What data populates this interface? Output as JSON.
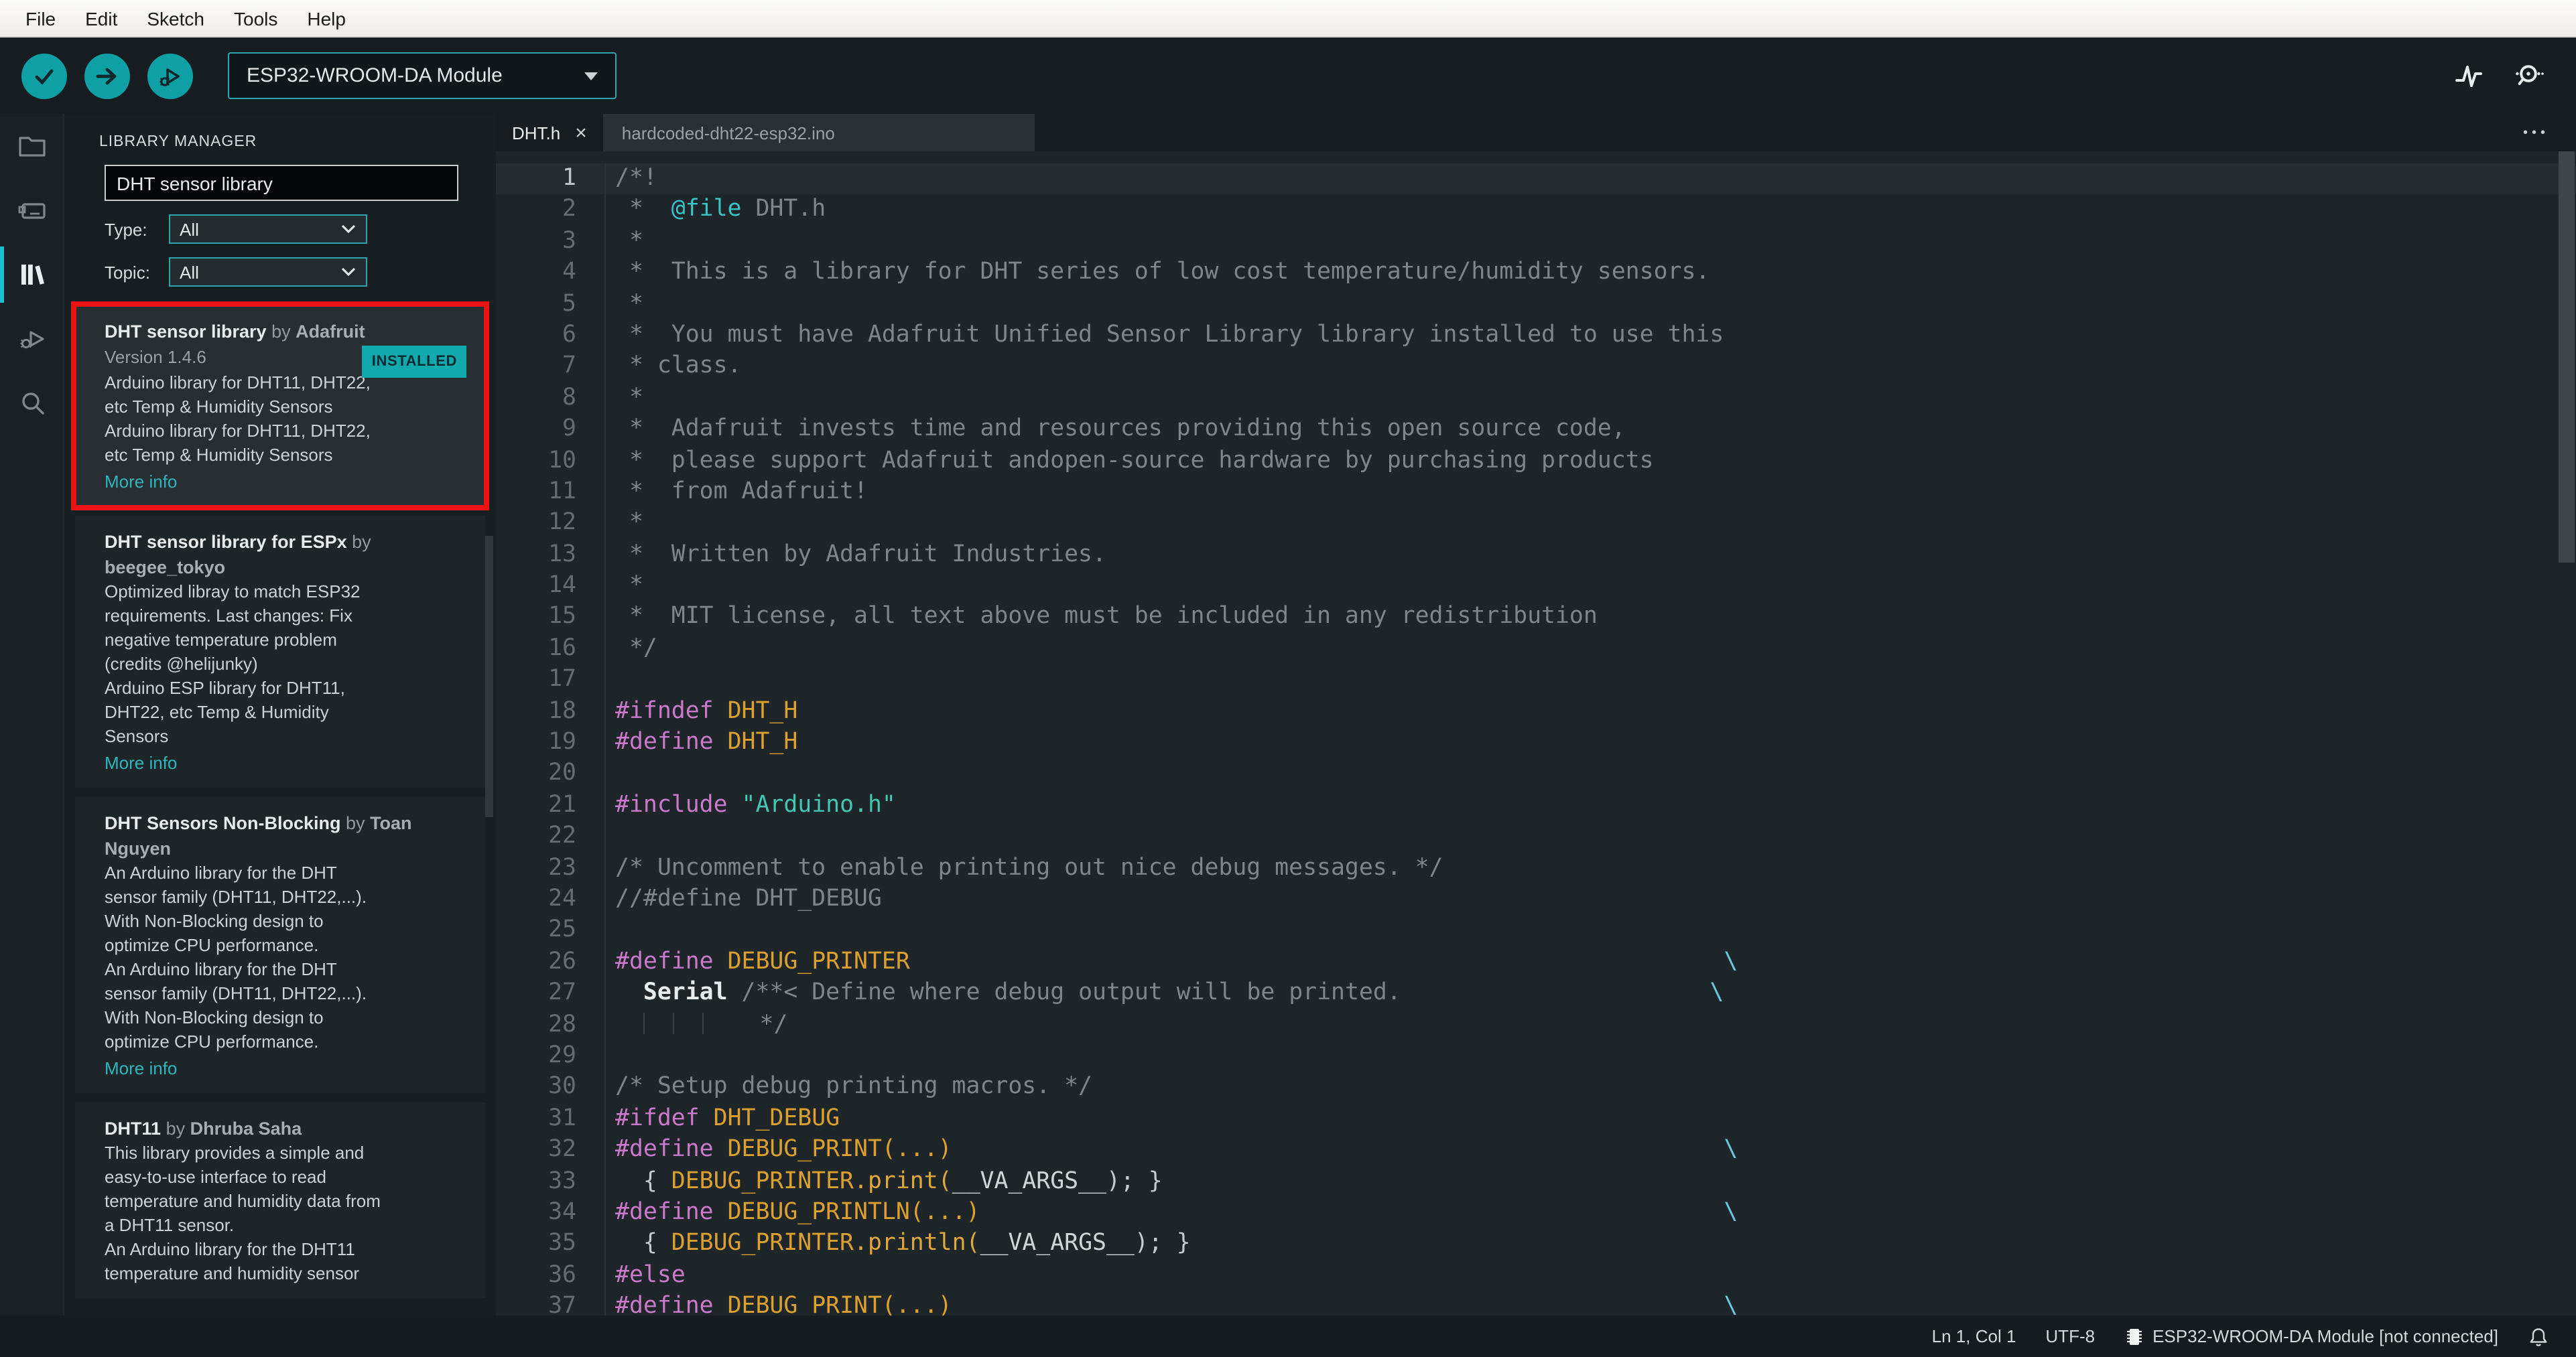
{
  "menu_bar": {
    "items": [
      "File",
      "Edit",
      "Sketch",
      "Tools",
      "Help"
    ]
  },
  "toolbar": {
    "buttons": [
      {
        "icon": "verify-check-icon"
      },
      {
        "icon": "upload-arrow-icon"
      },
      {
        "icon": "debug-icon"
      }
    ],
    "board_selector": {
      "value": "ESP32-WROOM-DA Module",
      "icon": "dropdown-caret-icon"
    },
    "right_icons": [
      {
        "icon": "serial-plotter-icon"
      },
      {
        "icon": "serial-monitor-icon"
      }
    ]
  },
  "activity_bar": {
    "items": [
      {
        "icon": "sketchbook-folder-icon",
        "active": false
      },
      {
        "icon": "boards-manager-icon",
        "active": false
      },
      {
        "icon": "library-manager-icon",
        "active": true
      },
      {
        "icon": "debug-sidebar-icon",
        "active": false
      },
      {
        "icon": "search-icon",
        "active": false
      }
    ]
  },
  "library_manager": {
    "title": "LIBRARY MANAGER",
    "search_value": "DHT sensor library",
    "filters": [
      {
        "label": "Type:",
        "value": "All"
      },
      {
        "label": "Topic:",
        "value": "All"
      }
    ],
    "libraries": [
      {
        "name": "DHT sensor library",
        "by": " by ",
        "author": "Adafruit",
        "version_label": "Version 1.4.6",
        "installed_badge": "INSTALLED",
        "description_lines": [
          "Arduino library for DHT11, DHT22,",
          "etc Temp & Humidity Sensors",
          "Arduino library for DHT11, DHT22,",
          "etc Temp & Humidity Sensors"
        ],
        "more_info": "More info",
        "selected": true,
        "annotated": true
      },
      {
        "name": "DHT sensor library for ESPx",
        "by": " by ",
        "author": "beegee_tokyo",
        "description_lines": [
          "Optimized libray to match ESP32",
          "requirements. Last changes: Fix",
          "negative temperature problem",
          "(credits @helijunky)",
          "Arduino ESP library for DHT11,",
          "DHT22, etc Temp & Humidity",
          "Sensors"
        ],
        "more_info": "More info",
        "selected": false,
        "annotated": false
      },
      {
        "name": "DHT Sensors Non-Blocking",
        "by": " by ",
        "author": "Toan Nguyen",
        "description_lines": [
          "An Arduino library for the DHT",
          "sensor family (DHT11, DHT22,...).",
          "With Non-Blocking design to",
          "optimize CPU performance.",
          "An Arduino library for the DHT",
          "sensor family (DHT11, DHT22,...).",
          "With Non-Blocking design to",
          "optimize CPU performance."
        ],
        "more_info": "More info",
        "selected": false,
        "annotated": false
      },
      {
        "name": "DHT11",
        "by": " by ",
        "author": "Dhruba Saha",
        "description_lines": [
          "This library provides a simple and",
          "easy-to-use interface to read",
          "temperature and humidity data from",
          "a DHT11 sensor.",
          "An Arduino library for the DHT11",
          "temperature and humidity sensor"
        ],
        "more_info": null,
        "selected": false,
        "annotated": false
      }
    ]
  },
  "editor": {
    "tabs": [
      {
        "label": "DHT.h",
        "active": true,
        "close_icon": "close-x-icon"
      },
      {
        "label": "hardcoded-dht22-esp32.ino",
        "active": false
      }
    ],
    "more_actions_label": "•••",
    "lines": [
      {
        "n": 1,
        "hl": true,
        "tk": [
          [
            "c",
            "/*!"
          ]
        ]
      },
      {
        "n": 2,
        "tk": [
          [
            "c",
            " *  "
          ],
          [
            "d",
            "@file"
          ],
          [
            "c",
            " DHT.h"
          ]
        ]
      },
      {
        "n": 3,
        "tk": [
          [
            "c",
            " *"
          ]
        ]
      },
      {
        "n": 4,
        "tk": [
          [
            "c",
            " *  This is a library for DHT series of low cost temperature/humidity sensors."
          ]
        ]
      },
      {
        "n": 5,
        "tk": [
          [
            "c",
            " *"
          ]
        ]
      },
      {
        "n": 6,
        "tk": [
          [
            "c",
            " *  You must have Adafruit Unified Sensor Library library installed to use this"
          ]
        ]
      },
      {
        "n": 7,
        "tk": [
          [
            "c",
            " * class."
          ]
        ]
      },
      {
        "n": 8,
        "tk": [
          [
            "c",
            " *"
          ]
        ]
      },
      {
        "n": 9,
        "tk": [
          [
            "c",
            " *  Adafruit invests time and resources providing this open source code,"
          ]
        ]
      },
      {
        "n": 10,
        "tk": [
          [
            "c",
            " *  please support Adafruit andopen-source hardware by purchasing products"
          ]
        ]
      },
      {
        "n": 11,
        "tk": [
          [
            "c",
            " *  from Adafruit!"
          ]
        ]
      },
      {
        "n": 12,
        "tk": [
          [
            "c",
            " *"
          ]
        ]
      },
      {
        "n": 13,
        "tk": [
          [
            "c",
            " *  Written by Adafruit Industries."
          ]
        ]
      },
      {
        "n": 14,
        "tk": [
          [
            "c",
            " *"
          ]
        ]
      },
      {
        "n": 15,
        "tk": [
          [
            "c",
            " *  MIT license, all text above must be included in any redistribution"
          ]
        ]
      },
      {
        "n": 16,
        "tk": [
          [
            "c",
            " */"
          ]
        ]
      },
      {
        "n": 17,
        "tk": []
      },
      {
        "n": 18,
        "tk": [
          [
            "p",
            "#ifndef"
          ],
          [
            "w",
            " "
          ],
          [
            "m",
            "DHT_H"
          ]
        ]
      },
      {
        "n": 19,
        "tk": [
          [
            "p",
            "#define"
          ],
          [
            "w",
            " "
          ],
          [
            "m",
            "DHT_H"
          ]
        ]
      },
      {
        "n": 20,
        "tk": []
      },
      {
        "n": 21,
        "tk": [
          [
            "p",
            "#include"
          ],
          [
            "w",
            " "
          ],
          [
            "s",
            "\"Arduino.h\""
          ]
        ]
      },
      {
        "n": 22,
        "tk": []
      },
      {
        "n": 23,
        "tk": [
          [
            "c",
            "/* Uncomment to enable printing out nice debug messages. */"
          ]
        ]
      },
      {
        "n": 24,
        "tk": [
          [
            "c",
            "//#define DHT_DEBUG"
          ]
        ]
      },
      {
        "n": 25,
        "tk": []
      },
      {
        "n": 26,
        "tk": [
          [
            "p",
            "#define"
          ],
          [
            "w",
            " "
          ],
          [
            "m",
            "DEBUG_PRINTER"
          ],
          [
            "w",
            "                                                          "
          ],
          [
            "b",
            "\\"
          ]
        ]
      },
      {
        "n": 27,
        "tk": [
          [
            "w",
            "  "
          ],
          [
            "S",
            "Serial"
          ],
          [
            "w",
            " "
          ],
          [
            "c",
            "/**< Define where debug output will be printed."
          ],
          [
            "w",
            "                      "
          ],
          [
            "b",
            "\\"
          ]
        ]
      },
      {
        "n": 28,
        "tk": [
          [
            "w",
            "  "
          ],
          [
            "g",
            ""
          ],
          [
            "w",
            "  "
          ],
          [
            "g",
            ""
          ],
          [
            "w",
            "  "
          ],
          [
            "g",
            ""
          ],
          [
            "w",
            "    "
          ],
          [
            "c",
            "*/"
          ]
        ]
      },
      {
        "n": 29,
        "tk": []
      },
      {
        "n": 30,
        "tk": [
          [
            "c",
            "/* Setup debug printing macros. */"
          ]
        ]
      },
      {
        "n": 31,
        "tk": [
          [
            "p",
            "#ifdef"
          ],
          [
            "w",
            " "
          ],
          [
            "m",
            "DHT_DEBUG"
          ]
        ]
      },
      {
        "n": 32,
        "tk": [
          [
            "p",
            "#define"
          ],
          [
            "w",
            " "
          ],
          [
            "m",
            "DEBUG_PRINT(...)"
          ],
          [
            "w",
            "                                                       "
          ],
          [
            "b",
            "\\"
          ]
        ]
      },
      {
        "n": 33,
        "tk": [
          [
            "w",
            "  { "
          ],
          [
            "m",
            "DEBUG_PRINTER"
          ],
          [
            "f",
            ".print("
          ],
          [
            "v",
            "__VA_ARGS__"
          ],
          [
            "w",
            "); }"
          ]
        ]
      },
      {
        "n": 34,
        "tk": [
          [
            "p",
            "#define"
          ],
          [
            "w",
            " "
          ],
          [
            "m",
            "DEBUG_PRINTLN(...)"
          ],
          [
            "w",
            "                                                     "
          ],
          [
            "b",
            "\\"
          ]
        ]
      },
      {
        "n": 35,
        "tk": [
          [
            "w",
            "  { "
          ],
          [
            "m",
            "DEBUG_PRINTER"
          ],
          [
            "f",
            ".println("
          ],
          [
            "v",
            "__VA_ARGS__"
          ],
          [
            "w",
            "); }"
          ]
        ]
      },
      {
        "n": 36,
        "tk": [
          [
            "p",
            "#else"
          ]
        ]
      },
      {
        "n": 37,
        "tk": [
          [
            "p",
            "#define"
          ],
          [
            "w",
            " "
          ],
          [
            "m",
            "DEBUG_PRINT(...)"
          ],
          [
            "w",
            "                                                       "
          ],
          [
            "b",
            "\\"
          ]
        ]
      }
    ]
  },
  "status_bar": {
    "cursor": "Ln 1, Col 1",
    "encoding": "UTF-8",
    "board": "ESP32-WROOM-DA Module [not connected]",
    "icons": [
      "chip-icon",
      "notification-bell-icon"
    ]
  },
  "colors": {
    "accent_teal": "#0fa0a6",
    "teal_border": "#2ba6ac",
    "annotation_red": "#ec1313",
    "installed_badge_bg": "#12a9ae",
    "link_teal": "#2fb6bd",
    "active_indicator": "#19c1cb"
  }
}
